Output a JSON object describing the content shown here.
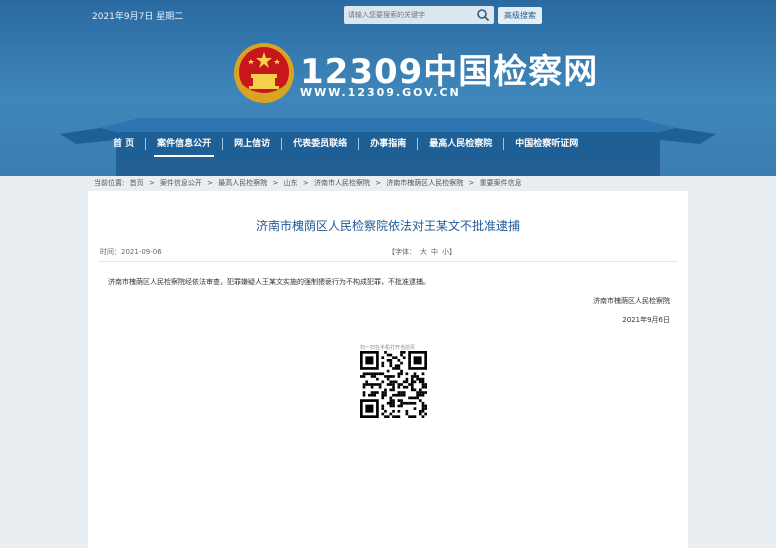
{
  "topbar": {
    "date": "2021年9月7日 星期二",
    "search_placeholder": "请输入您要搜索的关键字",
    "advanced_search": "高级搜索"
  },
  "logo": {
    "number": "12309中国检察网",
    "url": "WWW.12309.GOV.CN"
  },
  "nav": {
    "items": [
      "首 页",
      "案件信息公开",
      "网上信访",
      "代表委员联络",
      "办事指南",
      "最高人民检察院",
      "中国检察听证网"
    ],
    "active_index": 1
  },
  "breadcrumb": {
    "label": "当前位置:",
    "items": [
      "首页",
      ">",
      "案件信息公开",
      ">",
      "最高人民检察院",
      ">",
      "山东",
      ">",
      "济南市人民检察院",
      ">",
      "济南市槐荫区人民检察院",
      ">",
      "重要案件信息"
    ]
  },
  "article": {
    "title": "济南市槐荫区人民检察院依法对王某文不批准逮捕",
    "time_label": "时间：2021-09-06",
    "font_label": "【字体：",
    "font_sizes": [
      "大",
      "中",
      "小】"
    ],
    "body": "济南市槐荫区人民检察院经依法审查，犯罪嫌疑人王某文实施的强制猥亵行为不构成犯罪，不批准逮捕。",
    "signature": "济南市槐荫区人民检察院",
    "sign_date": "2021年9月6日",
    "qr_caption": "扫一扫在手机打开当前页"
  },
  "colors": {
    "header_blue": "#3f87bb",
    "title_blue": "#1d5a9a"
  }
}
